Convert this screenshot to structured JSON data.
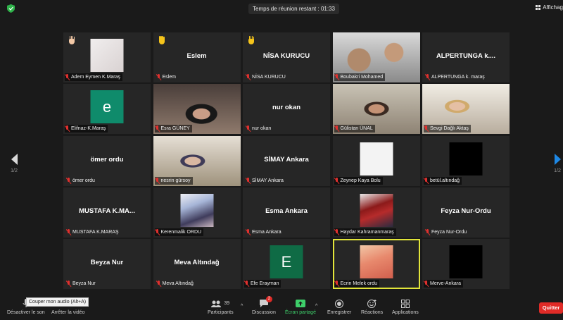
{
  "top": {
    "timer": "Temps de réunion restant : 01:33",
    "view_label": "Affichag"
  },
  "pages": {
    "left": "1/2",
    "right": "1/2"
  },
  "tiles": [
    {
      "label": "Adem Eymen  K.Maraş",
      "hand": "peach",
      "avatar": "pale"
    },
    {
      "label": "Eslem",
      "big": "Eslem",
      "hand": "yellow"
    },
    {
      "label": "NİSA KURUCU",
      "big": "NİSA KURUCU",
      "hand": "yellow"
    },
    {
      "label": "Boubakri Mohamed",
      "video": "bou"
    },
    {
      "label": "ALPERTUNGA k. maraş",
      "big": "ALPERTUNGA k...."
    },
    {
      "label": "Elifnaz-K.Maraş",
      "avatar": "teal",
      "initial": "e"
    },
    {
      "label": "Esra GÜNEY",
      "video": "esra"
    },
    {
      "label": "nur okan",
      "big": "nur okan"
    },
    {
      "label": "Gülistan ÜNAL",
      "video": "gul"
    },
    {
      "label": "Sevgi Dağlı Aktaş",
      "video": "sev"
    },
    {
      "label": "ömer ordu",
      "big": "ömer ordu"
    },
    {
      "label": "nesrin gürsoy",
      "video": "nes"
    },
    {
      "label": "SİMAY Ankara",
      "big": "SİMAY Ankara"
    },
    {
      "label": "Zeynep Kaya Bolu",
      "avatar": "white"
    },
    {
      "label": "betül.altındağ",
      "avatar": "black"
    },
    {
      "label": "MUSTAFA K.MARAŞ",
      "big": "MUSTAFA  K.MA..."
    },
    {
      "label": "Kerenmalik ORDU",
      "avatar": "anime"
    },
    {
      "label": "Esma Ankara",
      "big": "Esma Ankara"
    },
    {
      "label": "Haydar Kahramanmaraş",
      "avatar": "spider"
    },
    {
      "label": "Feyza Nur-Ordu",
      "big": "Feyza Nur-Ordu"
    },
    {
      "label": "Beyza Nur",
      "big": "Beyza Nur"
    },
    {
      "label": "Meva Altındağ",
      "big": "Meva Altındağ"
    },
    {
      "label": "Efe Erayman",
      "avatar": "green",
      "initial": "E"
    },
    {
      "label": "Ecrin Melek ordu",
      "avatar": "ecrin",
      "active": true
    },
    {
      "label": "Merve-Ankara",
      "avatar": "black"
    }
  ],
  "toolbar": {
    "mute_label": "Désactiver le son",
    "video_label": "Arrêter la vidéo",
    "participants_label": "Participants",
    "participants_count": "39",
    "chat_label": "Discussion",
    "chat_badge": "2",
    "share_label": "Écran partagé",
    "record_label": "Enregistrer",
    "reactions_label": "Réactions",
    "apps_label": "Applications",
    "quit_label": "Quitter",
    "tooltip": "Couper mon audio (Alt+A)"
  },
  "colors": {
    "background": "#1a1a1a",
    "tile": "#262626",
    "active_border": "#e2e53a",
    "quit": "#e02b27",
    "share_green": "#3ecf6a",
    "next_arrow": "#1e88e5"
  }
}
